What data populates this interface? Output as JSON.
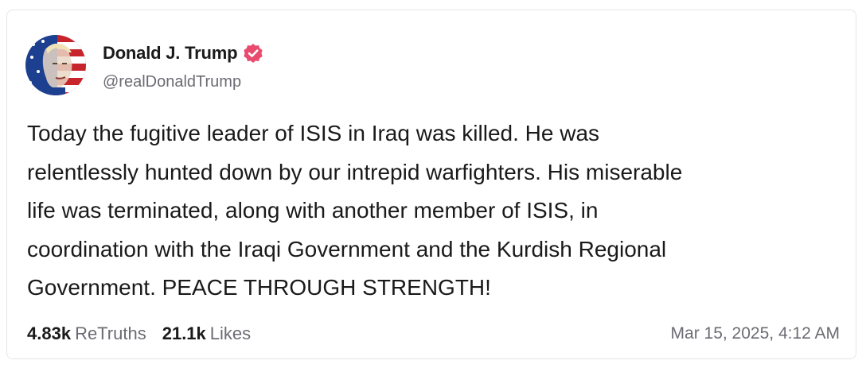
{
  "post": {
    "author": {
      "display_name": "Donald J. Trump",
      "handle": "@realDonaldTrump",
      "verified_icon": "verified-badge-icon",
      "verified_color": "#e94b6f"
    },
    "text": "Today the fugitive leader of ISIS in Iraq was killed. He was\nrelentlessly hunted down by our intrepid warfighters. His miserable\nlife was terminated, along with another member of ISIS, in\ncoordination with the Iraqi Government and the Kurdish Regional\nGovernment. PEACE THROUGH STRENGTH!",
    "stats": {
      "retruths_count": "4.83k",
      "retruths_label": "ReTruths",
      "likes_count": "21.1k",
      "likes_label": "Likes"
    },
    "timestamp": "Mar 15, 2025, 4:12 AM"
  }
}
